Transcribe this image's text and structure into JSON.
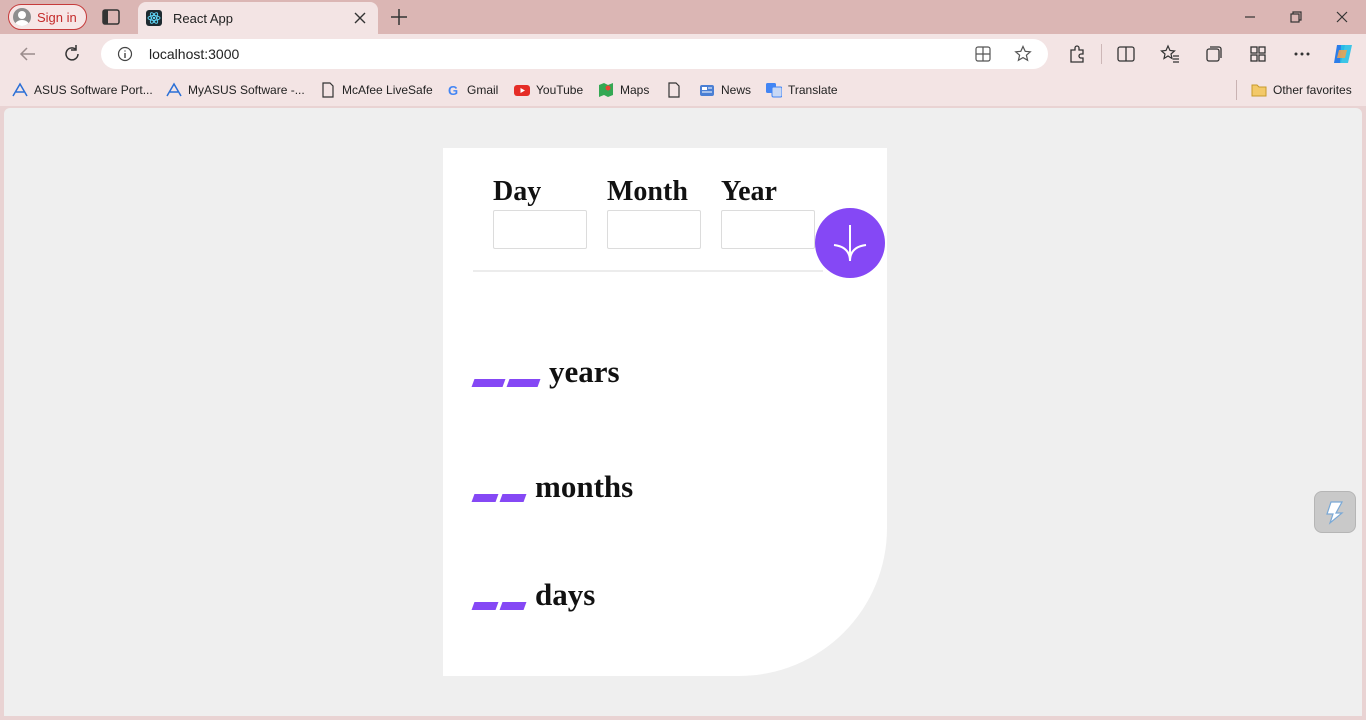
{
  "browser": {
    "sign_in_label": "Sign in",
    "tab_title": "React App",
    "url": "localhost:3000",
    "bookmarks": [
      {
        "label": "ASUS Software Port...",
        "icon": "asus-icon"
      },
      {
        "label": "MyASUS Software -...",
        "icon": "asus-icon"
      },
      {
        "label": "McAfee LiveSafe",
        "icon": "page-icon"
      },
      {
        "label": "Gmail",
        "icon": "google-icon"
      },
      {
        "label": "YouTube",
        "icon": "youtube-icon"
      },
      {
        "label": "Maps",
        "icon": "maps-icon"
      },
      {
        "label": "",
        "icon": "page-icon"
      },
      {
        "label": "News",
        "icon": "news-icon"
      },
      {
        "label": "Translate",
        "icon": "translate-icon"
      }
    ],
    "other_favorites": "Other favorites"
  },
  "app": {
    "fields": [
      {
        "label": "Day",
        "value": ""
      },
      {
        "label": "Month",
        "value": ""
      },
      {
        "label": "Year",
        "value": ""
      }
    ],
    "submit_icon": "arrow-down-icon",
    "results": [
      {
        "value": "--",
        "unit": "years"
      },
      {
        "value": "--",
        "unit": "months"
      },
      {
        "value": "--",
        "unit": "days"
      }
    ],
    "accent_color": "#8548f5"
  }
}
